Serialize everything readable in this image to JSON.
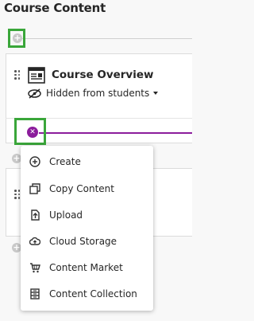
{
  "header": {
    "title": "Course Content"
  },
  "item": {
    "title": "Course Overview",
    "visibility": "Hidden from students"
  },
  "add_menu": {
    "items": [
      {
        "label": "Create",
        "icon": "plus-circle-icon"
      },
      {
        "label": "Copy Content",
        "icon": "copy-icon"
      },
      {
        "label": "Upload",
        "icon": "upload-icon"
      },
      {
        "label": "Cloud Storage",
        "icon": "cloud-icon"
      },
      {
        "label": "Content Market",
        "icon": "cart-icon"
      },
      {
        "label": "Content Collection",
        "icon": "collection-icon"
      }
    ]
  },
  "colors": {
    "accent_purple": "#8c1d9c",
    "highlight_green": "#3aa63a"
  }
}
